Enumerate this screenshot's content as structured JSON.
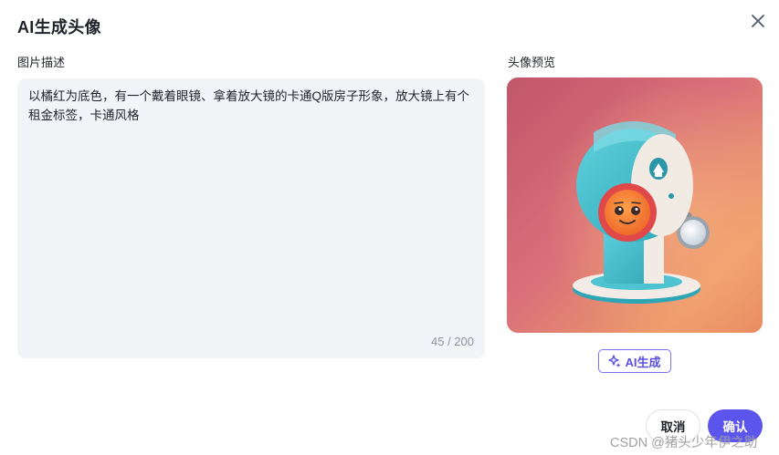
{
  "dialog": {
    "title": "AI生成头像",
    "close_icon": "close-icon"
  },
  "description": {
    "label": "图片描述",
    "text": "以橘红为底色，有一个戴着眼镜、拿着放大镜的卡通Q版房子形象，放大镜上有个租金标签，卡通风格",
    "counter": "45 / 200"
  },
  "preview": {
    "label": "头像预览",
    "image": "cartoon-house-with-magnifier-avatar"
  },
  "ai_generate": {
    "label": "AI生成",
    "icon": "sparkle-icon"
  },
  "footer": {
    "cancel_label": "取消",
    "confirm_label": "确认"
  },
  "watermark": "CSDN @猪头少年伊之助",
  "colors": {
    "accent": "#5b55ee",
    "ai_border": "#7b6ff2",
    "textarea_bg": "#f3f4f8",
    "counter_text": "#8f959e"
  }
}
